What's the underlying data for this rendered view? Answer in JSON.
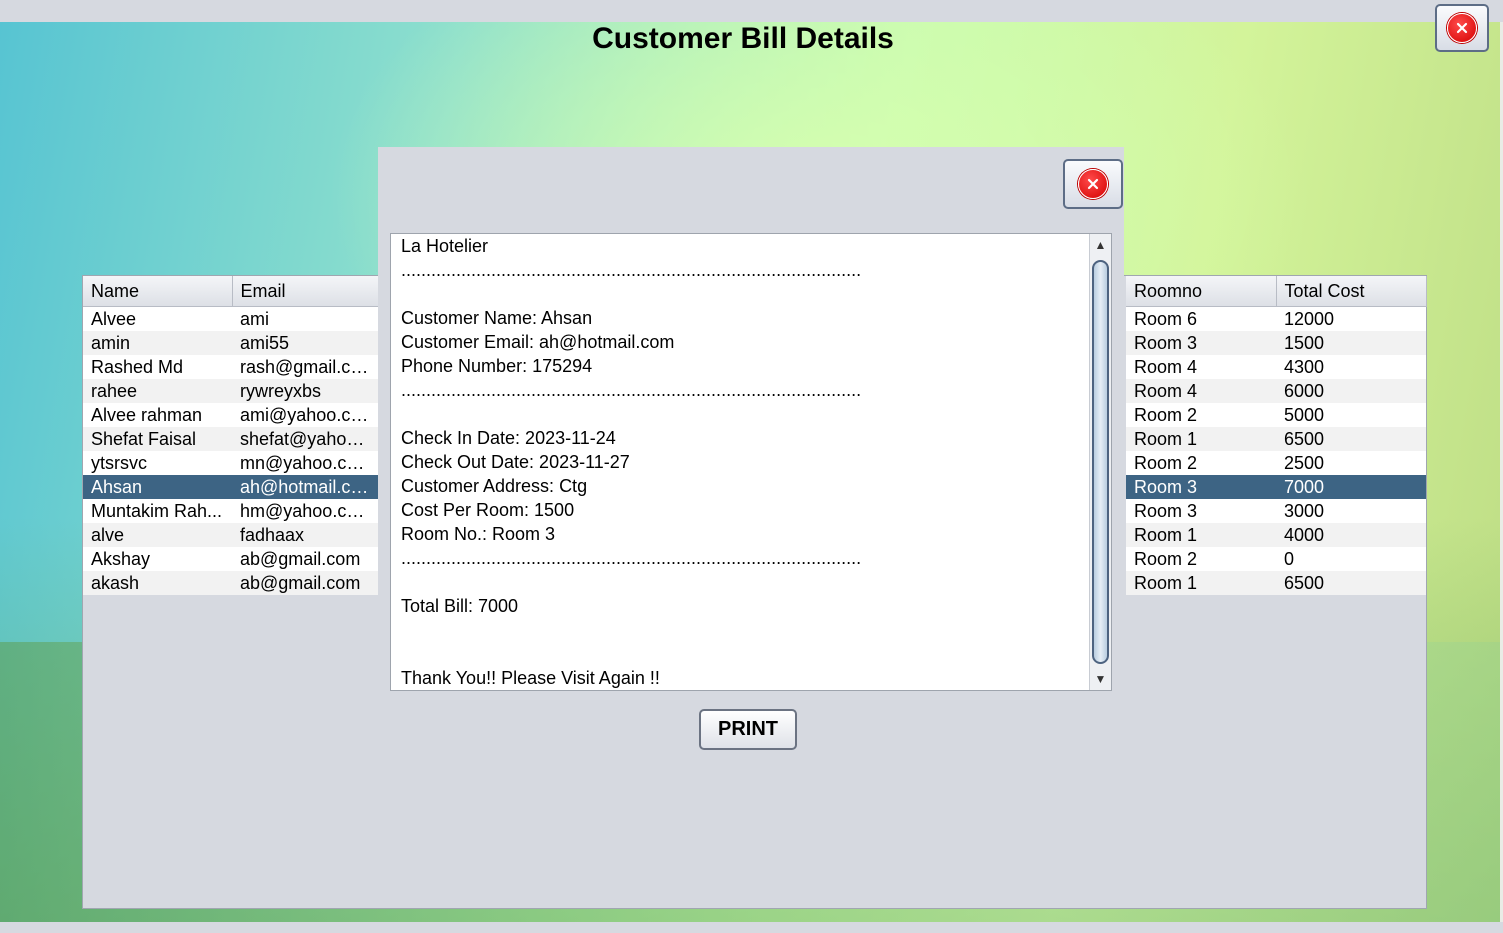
{
  "window": {
    "title": "Customer Bill Details",
    "close_icon": "close-icon"
  },
  "left_table": {
    "columns": [
      "Name",
      "Email"
    ],
    "selected_index": 7,
    "rows": [
      [
        "Alvee",
        "ami"
      ],
      [
        "amin",
        "ami55"
      ],
      [
        "Rashed Md",
        "rash@gmail.com"
      ],
      [
        "rahee",
        "rywreyxbs"
      ],
      [
        "Alvee rahman",
        "ami@yahoo.com"
      ],
      [
        "Shefat Faisal",
        "shefat@yahoo..."
      ],
      [
        "ytsrsvc",
        "mn@yahoo.com"
      ],
      [
        "Ahsan",
        "ah@hotmail.com"
      ],
      [
        "Muntakim Rah...",
        "hm@yahoo.com"
      ],
      [
        "alve",
        "fadhaax"
      ],
      [
        "Akshay",
        "ab@gmail.com"
      ],
      [
        "akash",
        "ab@gmail.com"
      ]
    ]
  },
  "right_table": {
    "columns": [
      "Roomno",
      "Total Cost"
    ],
    "selected_index": 7,
    "rows": [
      [
        "Room 6",
        "12000"
      ],
      [
        "Room 3",
        "1500"
      ],
      [
        "Room 4",
        "4300"
      ],
      [
        "Room 4",
        "6000"
      ],
      [
        "Room 2",
        "5000"
      ],
      [
        "Room 1",
        "6500"
      ],
      [
        "Room 2",
        "2500"
      ],
      [
        "Room 3",
        "7000"
      ],
      [
        "Room 3",
        "3000"
      ],
      [
        "Room 1",
        "4000"
      ],
      [
        "Room 2",
        "0"
      ],
      [
        "Room 1",
        "6500"
      ]
    ]
  },
  "dialog": {
    "close_icon": "close-icon",
    "bill_lines": [
      "La Hotelier",
      "............................................................................................",
      "",
      "Customer Name: Ahsan",
      "Customer Email: ah@hotmail.com",
      "Phone Number: 175294",
      "............................................................................................",
      "",
      "Check In Date: 2023-11-24",
      "Check Out Date: 2023-11-27",
      "Customer Address: Ctg",
      "Cost Per Room: 1500",
      "Room No.: Room 3",
      "............................................................................................",
      "",
      "Total Bill: 7000",
      "",
      "",
      "Thank You!! Please Visit Again !!"
    ],
    "print_label": "PRINT"
  }
}
